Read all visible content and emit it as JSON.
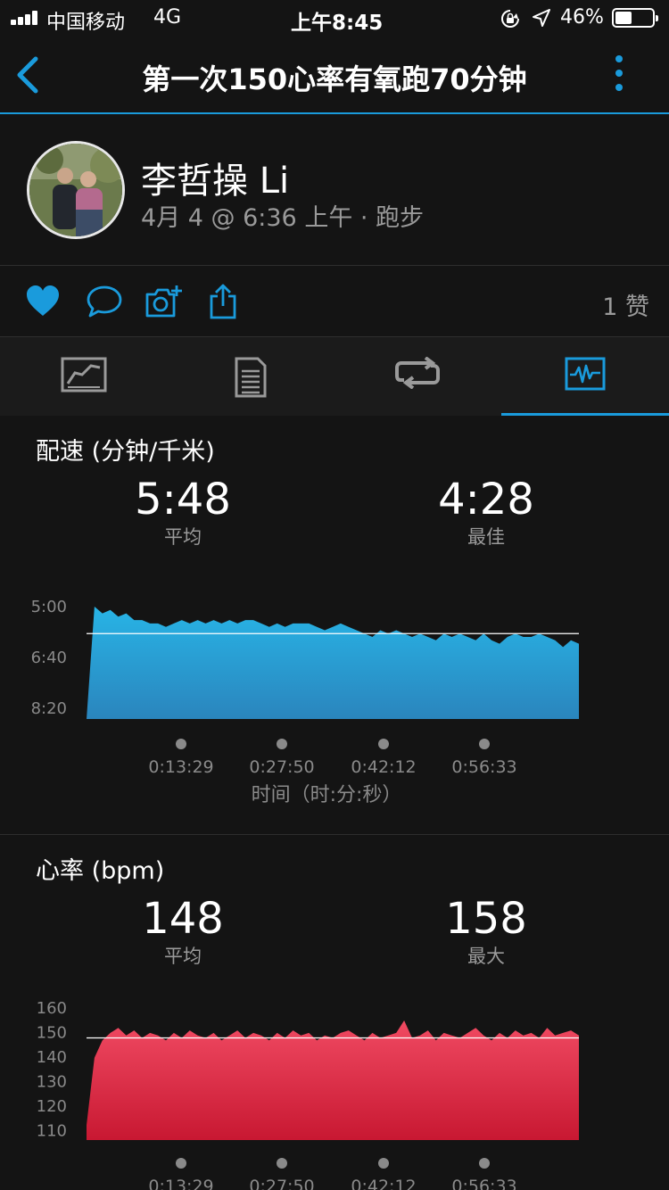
{
  "status_bar": {
    "carrier": "中国移动",
    "network": "4G",
    "time": "上午8:45",
    "battery": "46%",
    "battery_level": 0.46
  },
  "nav": {
    "title": "第一次150心率有氧跑70分钟",
    "back_icon": "chevron-left",
    "more_icon": "vertical-ellipsis",
    "accent": "#1a9bdc"
  },
  "profile": {
    "name": "李哲操 Li",
    "meta": "4月 4 @ 6:36 上午 · 跑步"
  },
  "actions": {
    "icons": [
      "heart",
      "comment",
      "camera-add",
      "share"
    ],
    "likes": "1 赞"
  },
  "tabs": [
    {
      "icon": "summary-chart",
      "active": false
    },
    {
      "icon": "details-list",
      "active": false
    },
    {
      "icon": "laps-loop",
      "active": false
    },
    {
      "icon": "charts-waveform",
      "active": true
    }
  ],
  "pace": {
    "title": "配速 (分钟/千米)",
    "avg_value": "5:48",
    "avg_label": "平均",
    "best_value": "4:28",
    "best_label": "最佳",
    "chart_data": {
      "type": "area",
      "y_axis_inverted": true,
      "y_ticks": [
        "5:00",
        "6:40",
        "8:20"
      ],
      "average_line": "5:48",
      "x_ticks": [
        "0:13:29",
        "0:27:50",
        "0:42:12",
        "0:56:33"
      ],
      "xlabel": "时间（时:分:秒）",
      "color": "#1fa8d8",
      "series": [
        {
          "values_min_per_km": [
            8.4,
            4.9,
            5.2,
            5.1,
            5.3,
            5.2,
            5.4,
            5.4,
            5.5,
            5.5,
            5.6,
            5.5,
            5.4,
            5.5,
            5.4,
            5.5,
            5.4,
            5.5,
            5.4,
            5.5,
            5.4,
            5.4,
            5.5,
            5.6,
            5.5,
            5.6,
            5.5,
            5.5,
            5.5,
            5.6,
            5.7,
            5.6,
            5.5,
            5.6,
            5.7,
            5.8,
            5.9,
            5.7,
            5.8,
            5.7,
            5.8,
            5.9,
            5.8,
            5.9,
            6.0,
            5.8,
            5.9,
            5.8,
            5.9,
            6.0,
            5.8,
            6.0,
            6.1,
            5.9,
            5.8,
            5.9,
            5.9,
            5.8,
            5.9,
            6.0,
            6.2,
            6.0,
            6.1
          ]
        }
      ]
    }
  },
  "hr": {
    "title": "心率 (bpm)",
    "avg_value": "148",
    "avg_label": "平均",
    "max_value": "158",
    "max_label": "最大",
    "chart_data": {
      "type": "area",
      "y_ticks": [
        "160",
        "150",
        "140",
        "130",
        "120",
        "110"
      ],
      "ylim": [
        110,
        160
      ],
      "average_line": 148,
      "x_ticks": [
        "0:13:29",
        "0:27:50",
        "0:42:12",
        "0:56:33"
      ],
      "color": "#e0304c",
      "series": [
        {
          "values_bpm": [
            113,
            140,
            147,
            150,
            152,
            149,
            151,
            148,
            150,
            149,
            147,
            150,
            148,
            151,
            149,
            148,
            150,
            147,
            149,
            151,
            148,
            150,
            149,
            147,
            150,
            148,
            151,
            149,
            150,
            147,
            149,
            148,
            150,
            151,
            149,
            147,
            150,
            148,
            149,
            150,
            155,
            148,
            149,
            151,
            147,
            150,
            149,
            148,
            150,
            152,
            149,
            147,
            150,
            148,
            151,
            149,
            150,
            148,
            152,
            149,
            150,
            151,
            149
          ]
        }
      ]
    }
  }
}
